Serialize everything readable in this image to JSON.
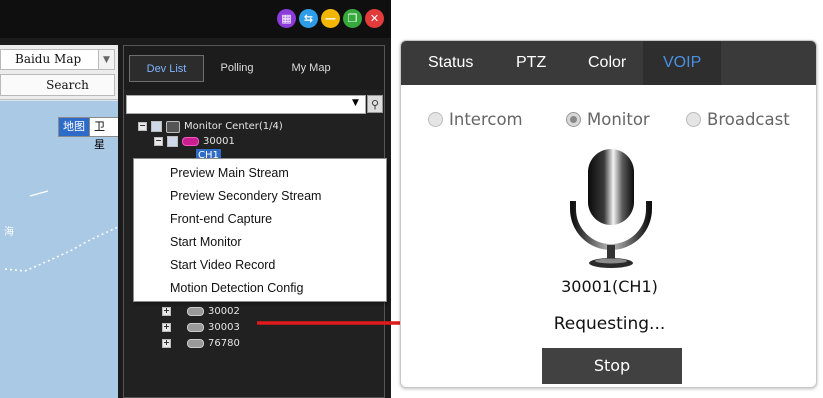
{
  "left_window": {
    "title_buttons": [
      {
        "name": "grid-icon",
        "color": "#8b3bd9",
        "glyph": "▦"
      },
      {
        "name": "swap-icon",
        "color": "#2f9ce8",
        "glyph": "⇆"
      },
      {
        "name": "minimize-icon",
        "color": "#f2b705",
        "glyph": "—"
      },
      {
        "name": "restore-icon",
        "color": "#36a83c",
        "glyph": "❐"
      },
      {
        "name": "close-icon",
        "color": "#e23b3b",
        "glyph": "✕"
      }
    ],
    "map": {
      "provider_selected": "Baidu Map",
      "search_label": "Search",
      "map_type_map": "地图",
      "map_type_satellite": "卫星",
      "place_label": "海"
    },
    "device_panel": {
      "tabs": [
        "Dev List",
        "Polling",
        "My Map"
      ],
      "tree": {
        "root_label": "Monitor Center(1/4)",
        "device_30001": "30001",
        "channel_label": "CH1",
        "devices_rest": [
          "30002",
          "30003",
          "76780"
        ]
      }
    },
    "context_menu": {
      "items": [
        "Preview Main Stream",
        "Preview Secondery Stream",
        "Front-end Capture",
        "Start Monitor",
        "Start Video Record",
        "Motion Detection Config"
      ]
    }
  },
  "voip_panel": {
    "tabs": [
      "Status",
      "PTZ",
      "Color",
      "VOIP"
    ],
    "active_tab": "VOIP",
    "active_tab_color": "#4a90e2",
    "radio_options": [
      "Intercom",
      "Monitor",
      "Broadcast"
    ],
    "selected_option": "Monitor",
    "device_label": "30001(CH1)",
    "status_text": "Requesting...",
    "stop_button": "Stop"
  },
  "arrow_color": "#e01b1b"
}
